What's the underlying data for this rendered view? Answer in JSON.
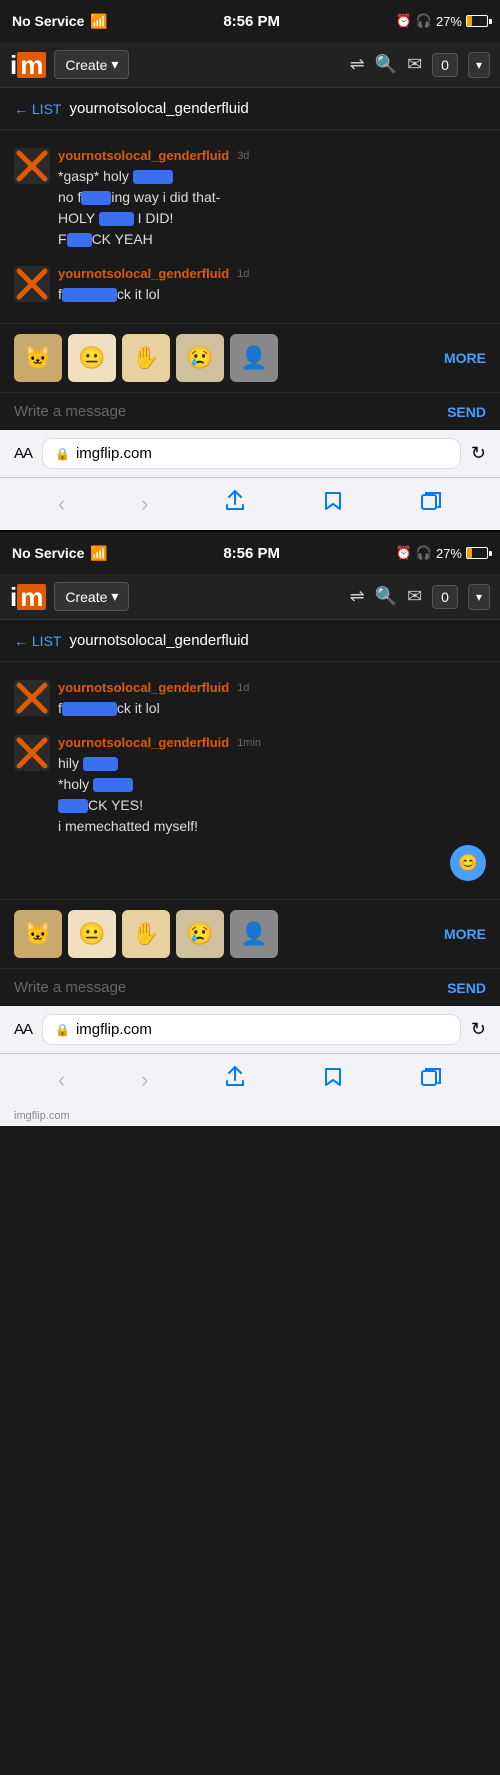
{
  "status_bar": {
    "signal": "No Service",
    "wifi": "📶",
    "time": "8:56 PM",
    "alarm": "⏰",
    "headphones": "🎧",
    "battery_percent": "27%"
  },
  "nav": {
    "logo_i": "i",
    "logo_m": "m",
    "create_label": "Create",
    "shuffle_icon": "⇌",
    "search_icon": "🔍",
    "mail_icon": "✉",
    "count": "0",
    "dropdown_icon": "▾"
  },
  "chat": {
    "back_label": "← LIST",
    "chat_user": "yournotsolocal_genderfluid",
    "messages_1": [
      {
        "username": "yournotsolocal_genderfluid",
        "time": "3d",
        "lines": [
          "*gasp* holy [CENSORED40]",
          "no f[CENSORED30]ing way i did that-",
          "HOLY [CENSORED35] I DID!",
          "F[CENSORED]CK YEAH"
        ]
      },
      {
        "username": "yournotsolocal_genderfluid",
        "time": "1d",
        "lines": [
          "f[CENSORED60]ck it lol"
        ]
      }
    ],
    "avatars": [
      "🐱",
      "😐",
      "✋",
      "😢",
      "👤"
    ],
    "more_label": "MORE",
    "input_placeholder": "Write a message",
    "send_label": "SEND"
  },
  "browser": {
    "aa_label": "AA",
    "lock_icon": "🔒",
    "url": "imgflip.com",
    "refresh_icon": "↻"
  },
  "browser_nav": {
    "back": "‹",
    "forward": "›",
    "share": "⬆",
    "bookmarks": "📖",
    "tabs": "⧉"
  },
  "chat2": {
    "back_label": "← LIST",
    "chat_user": "yournotsolocal_genderfluid",
    "messages": [
      {
        "username": "yournotsolocal_genderfluid",
        "time": "1d",
        "lines": [
          "f[CENSORED60]ck it lol"
        ]
      },
      {
        "username": "yournotsolocal_genderfluid",
        "time": "1min",
        "lines": [
          "hily [CENSORED35]",
          "*holy [CENSORED40]",
          "[CENSORED]CK YES!",
          "i memechatted myself!"
        ]
      }
    ],
    "avatars": [
      "🐱",
      "😐",
      "✋",
      "😢",
      "👤"
    ],
    "more_label": "MORE",
    "input_placeholder": "Write a message",
    "send_label": "SEND"
  }
}
